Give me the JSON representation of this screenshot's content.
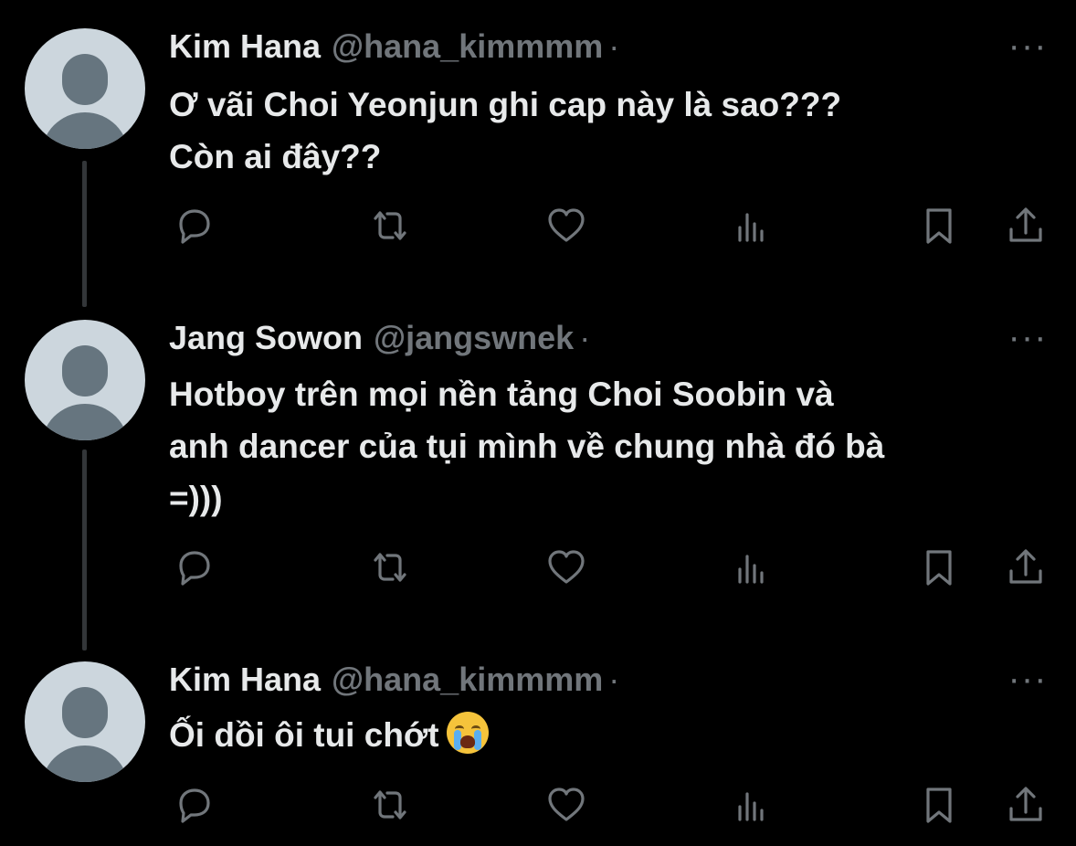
{
  "tweets": [
    {
      "name": "Kim Hana",
      "handle": "@hana_kimmmm",
      "separator": "·",
      "more": "···",
      "lines": [
        "Ơ vãi Choi Yeonjun ghi cap này là sao???",
        "Còn ai đây??"
      ],
      "emoji": null
    },
    {
      "name": "Jang Sowon",
      "handle": "@jangswnek",
      "separator": "·",
      "more": "···",
      "lines": [
        "Hotboy trên mọi nền tảng Choi Soobin và",
        "anh dancer của tụi mình về chung nhà đó bà",
        "=)))"
      ],
      "emoji": null
    },
    {
      "name": "Kim Hana",
      "handle": "@hana_kimmmm",
      "separator": "·",
      "more": "···",
      "lines": [
        "Ối dồi ôi tui chớt"
      ],
      "emoji": "loudly-crying-face"
    }
  ],
  "actions": [
    "reply-icon",
    "retweet-icon",
    "like-icon",
    "views-icon",
    "bookmark-icon",
    "share-icon"
  ],
  "colors": {
    "background": "#000000",
    "text": "#e7e9ea",
    "muted": "#71767b",
    "thread_line": "#333639",
    "avatar_bg": "#ccd6dd",
    "avatar_fg": "#66757f"
  }
}
